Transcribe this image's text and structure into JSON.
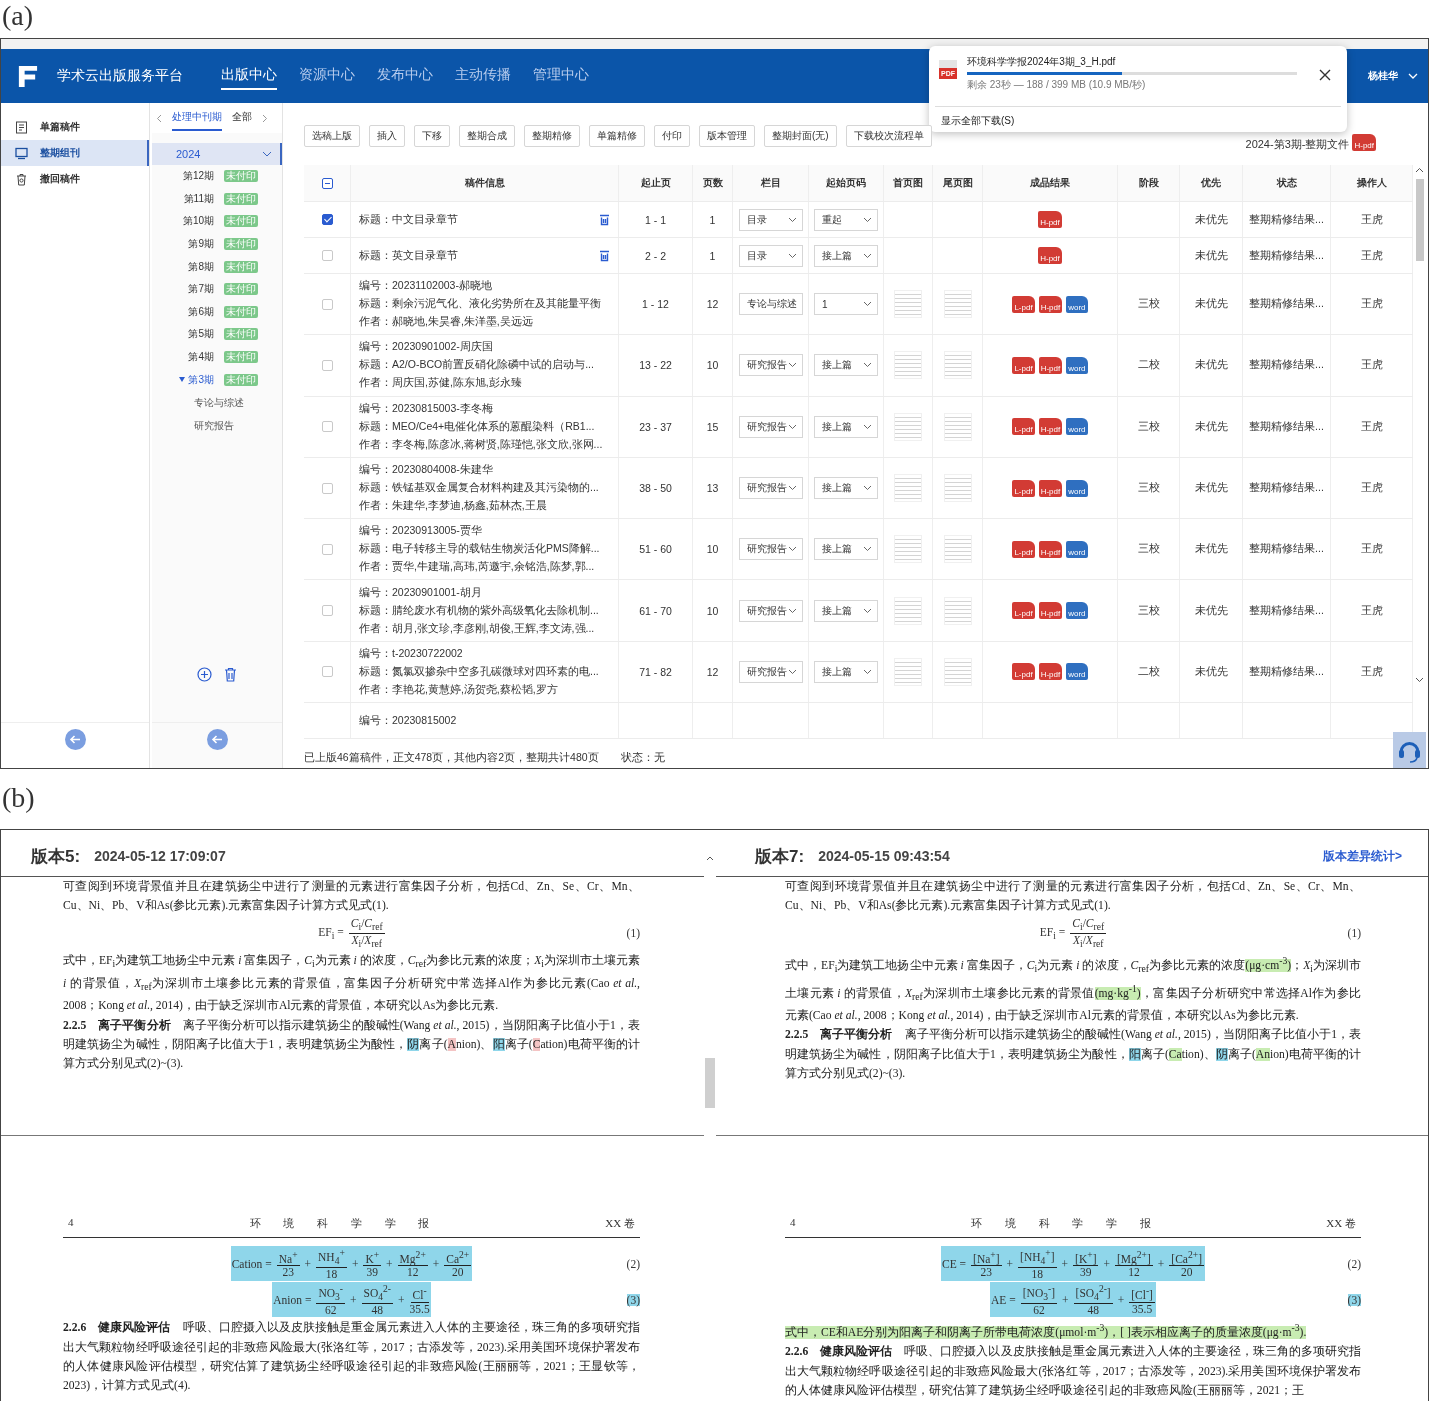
{
  "panel_a": {
    "label": "(a)",
    "header": {
      "platform_name": "学术云出版服务平台",
      "nav": [
        {
          "label": "出版中心",
          "selected": true
        },
        {
          "label": "资源中心",
          "selected": false
        },
        {
          "label": "发布中心",
          "selected": false
        },
        {
          "label": "主动传播",
          "selected": false
        },
        {
          "label": "管理中心",
          "selected": false
        }
      ],
      "user": "杨桂华"
    },
    "download_popup": {
      "file_name": "环境科学学报2024年3期_3_H.pdf",
      "file_badge": "PDF",
      "level": 0.47,
      "status": "剩余 23秒 — 188 / 399 MB (10.9 MB/秒)",
      "show_all": "显示全部下载(S)"
    },
    "sidebar": [
      {
        "label": "单篇稿件",
        "kind": "document",
        "selected": false
      },
      {
        "label": "整期组刊",
        "kind": "monitor",
        "selected": true
      },
      {
        "label": "撤回稿件",
        "kind": "trash",
        "selected": false
      }
    ],
    "issue_panel": {
      "tabs": [
        {
          "label": "处理中刊期",
          "selected": true
        },
        {
          "label": "全部",
          "selected": false
        }
      ],
      "years": [
        {
          "label": "2024",
          "expanded": true,
          "issues": [
            {
              "label": "第12期",
              "badge": "未付印",
              "selected": false,
              "expanded": false
            },
            {
              "label": "第11期",
              "badge": "未付印",
              "selected": false,
              "expanded": false
            },
            {
              "label": "第10期",
              "badge": "未付印",
              "selected": false,
              "expanded": false
            },
            {
              "label": "第9期",
              "badge": "未付印",
              "selected": false,
              "expanded": false
            },
            {
              "label": "第8期",
              "badge": "未付印",
              "selected": false,
              "expanded": false
            },
            {
              "label": "第7期",
              "badge": "未付印",
              "selected": false,
              "expanded": false
            },
            {
              "label": "第6期",
              "badge": "未付印",
              "selected": false,
              "expanded": false
            },
            {
              "label": "第5期",
              "badge": "未付印",
              "selected": false,
              "expanded": false
            },
            {
              "label": "第4期",
              "badge": "未付印",
              "selected": false,
              "expanded": false
            },
            {
              "label": "第3期",
              "badge": "未付印",
              "selected": true,
              "expanded": true,
              "children": [
                {
                  "label": "专论与综述"
                },
                {
                  "label": "研究报告"
                }
              ]
            }
          ]
        }
      ]
    },
    "toolbar": [
      "选稿上版",
      "插入",
      "下移",
      "整期合成",
      "整期精修",
      "单篇精修",
      "付印",
      "版本管理",
      "整期封面(无)",
      "下载校次流程单"
    ],
    "issue_file": {
      "label": "2024-第3期-整期文件",
      "badge": "H-pdf"
    },
    "table": {
      "select_all_partial": true,
      "columns": [
        "稿件信息",
        "起止页",
        "页数",
        "栏目",
        "起始页码",
        "首页图",
        "尾页图",
        "成品结果",
        "阶段",
        "优先",
        "状态",
        "操作人"
      ],
      "rows": [
        {
          "checked": true,
          "lines": [
            "标题：中文目录章节"
          ],
          "deletable": true,
          "pages": "1 - 1",
          "page_count": "1",
          "column": "目录",
          "start_page": "重起",
          "thumbnails": false,
          "outputs": [
            {
              "kind": "pdf",
              "label": "H-pdf"
            }
          ],
          "priority": "未优先",
          "status": "整期精修结果...",
          "operator": "王虎"
        },
        {
          "checked": false,
          "lines": [
            "标题：英文目录章节"
          ],
          "deletable": true,
          "pages": "2 - 2",
          "page_count": "1",
          "column": "目录",
          "start_page": "接上篇",
          "thumbnails": false,
          "outputs": [
            {
              "kind": "pdf",
              "label": "H-pdf"
            }
          ],
          "priority": "未优先",
          "status": "整期精修结果...",
          "operator": "王虎"
        },
        {
          "checked": false,
          "lines": [
            "编号：20231102003-郝晓地",
            "标题：剩余污泥气化、液化劣势所在及其能量平衡",
            "作者：郝晓地,朱昊睿,朱洋墨,吴远远"
          ],
          "deletable": false,
          "pages": "1 - 12",
          "page_count": "12",
          "column": "专论与综述",
          "start_page": "1",
          "thumbnails": true,
          "outputs": [
            {
              "kind": "pdf",
              "label": "L-pdf"
            },
            {
              "kind": "pdf",
              "label": "H-pdf"
            },
            {
              "kind": "word",
              "label": "word"
            }
          ],
          "stage": "三校",
          "priority": "未优先",
          "status": "整期精修结果...",
          "operator": "王虎"
        },
        {
          "checked": false,
          "lines": [
            "编号：20230901002-周庆国",
            "标题：A2/O-BCO前置反硝化除磷中试的启动与...",
            "作者：周庆国,苏健,陈东旭,彭永臻"
          ],
          "deletable": false,
          "pages": "13 - 22",
          "page_count": "10",
          "column": "研究报告",
          "start_page": "接上篇",
          "thumbnails": true,
          "outputs": [
            {
              "kind": "pdf",
              "label": "L-pdf"
            },
            {
              "kind": "pdf",
              "label": "H-pdf"
            },
            {
              "kind": "word",
              "label": "word"
            }
          ],
          "stage": "二校",
          "priority": "未优先",
          "status": "整期精修结果...",
          "operator": "王虎"
        },
        {
          "checked": false,
          "lines": [
            "编号：20230815003-李冬梅",
            "标题：MEO/Ce4+电催化体系的蒽醌染料（RB1...",
            "作者：李冬梅,陈彦冰,蒋树贤,陈瑾恺,张文欣,张网..."
          ],
          "deletable": false,
          "pages": "23 - 37",
          "page_count": "15",
          "column": "研究报告",
          "start_page": "接上篇",
          "thumbnails": true,
          "outputs": [
            {
              "kind": "pdf",
              "label": "L-pdf"
            },
            {
              "kind": "pdf",
              "label": "H-pdf"
            },
            {
              "kind": "word",
              "label": "word"
            }
          ],
          "stage": "三校",
          "priority": "未优先",
          "status": "整期精修结果...",
          "operator": "王虎"
        },
        {
          "checked": false,
          "lines": [
            "编号：20230804008-朱建华",
            "标题：铁锰基双金属复合材料构建及其污染物的...",
            "作者：朱建华,李梦迪,杨鑫,茹林杰,王晨"
          ],
          "deletable": false,
          "pages": "38 - 50",
          "page_count": "13",
          "column": "研究报告",
          "start_page": "接上篇",
          "thumbnails": true,
          "outputs": [
            {
              "kind": "pdf",
              "label": "L-pdf"
            },
            {
              "kind": "pdf",
              "label": "H-pdf"
            },
            {
              "kind": "word",
              "label": "word"
            }
          ],
          "stage": "三校",
          "priority": "未优先",
          "status": "整期精修结果...",
          "operator": "王虎"
        },
        {
          "checked": false,
          "lines": [
            "编号：20230913005-贾华",
            "标题：电子转移主导的载钴生物炭活化PMS降解...",
            "作者：贾华,牛建瑞,高玮,芮邀宇,余铭浩,陈梦,郭..."
          ],
          "deletable": false,
          "pages": "51 - 60",
          "page_count": "10",
          "column": "研究报告",
          "start_page": "接上篇",
          "thumbnails": true,
          "outputs": [
            {
              "kind": "pdf",
              "label": "L-pdf"
            },
            {
              "kind": "pdf",
              "label": "H-pdf"
            },
            {
              "kind": "word",
              "label": "word"
            }
          ],
          "stage": "三校",
          "priority": "未优先",
          "status": "整期精修结果...",
          "operator": "王虎"
        },
        {
          "checked": false,
          "lines": [
            "编号：20230901001-胡月",
            "标题：腈纶废水有机物的紫外高级氧化去除机制...",
            "作者：胡月,张文珍,李彦刚,胡俊,王辉,李文涛,强..."
          ],
          "deletable": false,
          "pages": "61 - 70",
          "page_count": "10",
          "column": "研究报告",
          "start_page": "接上篇",
          "thumbnails": true,
          "outputs": [
            {
              "kind": "pdf",
              "label": "L-pdf"
            },
            {
              "kind": "pdf",
              "label": "H-pdf"
            },
            {
              "kind": "word",
              "label": "word"
            }
          ],
          "stage": "三校",
          "priority": "未优先",
          "status": "整期精修结果...",
          "operator": "王虎"
        },
        {
          "checked": false,
          "lines": [
            "编号：t-20230722002",
            "标题：氮氯双掺杂中空多孔碳微球对四环素的电...",
            "作者：李艳花,黄慧婷,汤贺尧,蔡松韬,罗方"
          ],
          "deletable": false,
          "pages": "71 - 82",
          "page_count": "12",
          "column": "研究报告",
          "start_page": "接上篇",
          "thumbnails": true,
          "outputs": [
            {
              "kind": "pdf",
              "label": "L-pdf"
            },
            {
              "kind": "pdf",
              "label": "H-pdf"
            },
            {
              "kind": "word",
              "label": "word"
            }
          ],
          "stage": "二校",
          "priority": "未优先",
          "status": "整期精修结果...",
          "operator": "王虎"
        },
        {
          "lines": [
            "编号：20230815002"
          ]
        }
      ]
    },
    "summary": "已上版46篇稿件，正文478页，其他内容2页，整期共计480页",
    "state_text": "状态：无"
  },
  "panel_b": {
    "label": "(b)",
    "views": [
      {
        "title": "版本5:",
        "date": "2024-05-12 17:09:07",
        "pages": [
          {
            "blocks": [
              {
                "kind": "paragraph",
                "segments": [
                  {
                    "text": "可查阅到环境背景值并且在建筑扬尘中进行了测量的元素进行富集因子分析，包括Cd、Zn、Se、Cr、Mn、Cu、Ni、Pb、V和As(参比元素).元素富集因子计算方式见式(1)."
                  }
                ]
              },
              {
                "kind": "equation",
                "lhs": "EF$_{i}$ =",
                "terms": [
                  {
                    "num": "*C*$_{i}$/*C*$_{ref}$",
                    "den": "*X*$_{i}$/*X*$_{ref}$"
                  }
                ],
                "number": "(1)",
                "number_highlighted": false
              },
              {
                "kind": "paragraph",
                "segments": [
                  {
                    "text": "式中，EF$_{i}$为建筑工地扬尘中元素 *i* 富集因子，*C*$_{i}$为元素 *i* 的浓度，*C*$_{ref}$为参比元素的浓度；*X*$_{i}$为深圳市土壤元素 *i* 的背景值，*X*$_{ref}$为深圳市土壤参比元素的背景值，富集因子分析研究中常选择Al作为参比元素(Cao *et al.*, 2008；Kong *et al.*, 2014)，由于缺乏深圳市Al元素的背景值，本研究以As为参比元素."
                  }
                ]
              },
              {
                "kind": "paragraph",
                "segments": [
                  {
                    "text": "**2.2.5　离子平衡分析**　离子平衡分析可以指示建筑扬尘的酸碱性(Wang *et al.*, 2015)，当阴阳离子比值小于1，表明建筑扬尘为碱性，阴阳离子比值大于1，表明建筑扬尘为酸性，"
                  },
                  {
                    "text": "阴",
                    "color": "#8fd6ea"
                  },
                  {
                    "text": "离子("
                  },
                  {
                    "text": "A",
                    "color": "#f4c4c4"
                  },
                  {
                    "text": "nion)、"
                  },
                  {
                    "text": "阳",
                    "color": "#8fd6ea"
                  },
                  {
                    "text": "离子("
                  },
                  {
                    "text": "C",
                    "color": "#f4c4c4"
                  },
                  {
                    "text": "ation)电荷平衡的计算方式分别见式(2)~(3)."
                  }
                ]
              }
            ]
          },
          {
            "running_head": {
              "page": "4",
              "journal": "环 境 科 学 学 报",
              "volume": "XX 卷"
            },
            "blocks": [
              {
                "kind": "equation",
                "lhs": "Cation =",
                "terms": [
                  {
                    "num": "Na$^{+}$",
                    "den": "23"
                  },
                  {
                    "op": "+",
                    "num": "NH$_{4}$$^{+}$",
                    "den": "18"
                  },
                  {
                    "op": "+",
                    "num": "K$^{+}$",
                    "den": "39"
                  },
                  {
                    "op": "+",
                    "num": "Mg$^{2+}$",
                    "den": "12"
                  },
                  {
                    "op": "+",
                    "num": "Ca$^{2+}$",
                    "den": "20"
                  }
                ],
                "number": "(2)",
                "color": "#8fd6ea",
                "number_highlighted": false
              },
              {
                "kind": "equation",
                "lhs": "Anion =",
                "terms": [
                  {
                    "num": "NO$_{3}$$^{-}$",
                    "den": "62"
                  },
                  {
                    "op": "+",
                    "num": "SO$_{4}$$^{2-}$",
                    "den": "48"
                  },
                  {
                    "op": "+",
                    "num": "Cl$^{-}$",
                    "den": "35.5"
                  }
                ],
                "number": "(3)",
                "color": "#8fd6ea",
                "number_highlighted": true
              },
              {
                "kind": "paragraph",
                "segments": [
                  {
                    "text": "**2.2.6　健康风险评估**　呼吸、口腔摄入以及皮肤接触是重金属元素进入人体的主要途径，珠三角的多项研究指出大气颗粒物经呼吸途径引起的非致癌风险最大(张洛红等，2017；古添发等，2023).采用美国环境保护署发布的人体健康风险评估模型，研究估算了建筑扬尘经呼吸途径引起的非致癌风险(王丽丽等，2021；王显钦等，2023)，计算方式见式(4)."
                  }
                ]
              }
            ]
          }
        ]
      },
      {
        "title": "版本7:",
        "date": "2024-05-15 09:43:54",
        "link": "版本差异统计>",
        "pages": [
          {
            "blocks": [
              {
                "kind": "paragraph",
                "segments": [
                  {
                    "text": "可查阅到环境背景值并且在建筑扬尘中进行了测量的元素进行富集因子分析，包括Cd、Zn、Se、Cr、Mn、Cu、Ni、Pb、V和As(参比元素).元素富集因子计算方式见式(1)."
                  }
                ]
              },
              {
                "kind": "equation",
                "lhs": "EF$_{i}$ =",
                "terms": [
                  {
                    "num": "*C*$_{i}$/*C*$_{ref}$",
                    "den": "*X*$_{i}$/*X*$_{ref}$"
                  }
                ],
                "number": "(1)",
                "number_highlighted": false
              },
              {
                "kind": "paragraph",
                "segments": [
                  {
                    "text": "式中，EF$_{i}$为建筑工地扬尘中元素 *i* 富集因子，*C*$_{i}$为元素 *i* 的浓度，*C*$_{ref}$为参比元素的浓度"
                  },
                  {
                    "text": "(μg·cm$^{-3}$)",
                    "color": "#c8ecb2"
                  },
                  {
                    "text": "；*X*$_{i}$为深圳市土壤元素 *i* 的背景值，*X*$_{ref}$为深圳市土壤参比元素的背景值"
                  },
                  {
                    "text": "(mg·kg$^{-1}$)",
                    "color": "#c8ecb2"
                  },
                  {
                    "text": "，富集因子分析研究中常选择Al作为参比元素(Cao *et al.*, 2008；Kong *et al.*, 2014)，由于缺乏深圳市Al元素的背景值，本研究以As为参比元素."
                  }
                ]
              },
              {
                "kind": "paragraph",
                "segments": [
                  {
                    "text": "**2.2.5　离子平衡分析**　离子平衡分析可以指示建筑扬尘的酸碱性(Wang *et al.*, 2015)，当阴阳离子比值小于1，表明建筑扬尘为碱性，阴阳离子比值大于1，表明建筑扬尘为酸性，"
                  },
                  {
                    "text": "阳",
                    "color": "#8fd6ea"
                  },
                  {
                    "text": "离子("
                  },
                  {
                    "text": "Ca",
                    "color": "#c8ecb2"
                  },
                  {
                    "text": "tion)、"
                  },
                  {
                    "text": "阴",
                    "color": "#8fd6ea"
                  },
                  {
                    "text": "离子("
                  },
                  {
                    "text": "An",
                    "color": "#c8ecb2"
                  },
                  {
                    "text": "ion)电荷平衡的计算方式分别见式(2)~(3)."
                  }
                ]
              }
            ]
          },
          {
            "running_head": {
              "page": "4",
              "journal": "环 境 科 学 学 报",
              "volume": "XX 卷"
            },
            "blocks": [
              {
                "kind": "equation",
                "lhs": "CE =",
                "terms": [
                  {
                    "num": "[Na$^{+}$]",
                    "den": "23"
                  },
                  {
                    "op": "+",
                    "num": "[NH$_{4}$$^{+}$]",
                    "den": "18"
                  },
                  {
                    "op": "+",
                    "num": "[K$^{+}$]",
                    "den": "39"
                  },
                  {
                    "op": "+",
                    "num": "[Mg$^{2+}$]",
                    "den": "12"
                  },
                  {
                    "op": "+",
                    "num": "[Ca$^{2+}$]",
                    "den": "20"
                  }
                ],
                "number": "(2)",
                "color": "#8fd6ea",
                "number_highlighted": false
              },
              {
                "kind": "equation",
                "lhs": "AE =",
                "terms": [
                  {
                    "num": "[NO$_{3}$$^{-}$]",
                    "den": "62"
                  },
                  {
                    "op": "+",
                    "num": "[SO$_{4}$$^{2-}$]",
                    "den": "48"
                  },
                  {
                    "op": "+",
                    "num": "[Cl$^{-}$]",
                    "den": "35.5"
                  }
                ],
                "number": "(3)",
                "color": "#8fd6ea",
                "number_highlighted": true
              },
              {
                "kind": "paragraph",
                "segments": [
                  {
                    "text": "式中，CE和AE分别为阳离子和阴离子所带电荷浓度(μmol·m$^{-3}$)，[ ]表示相应离子的质量浓度(μg·m$^{-3}$).",
                    "color": "#c8ecb2"
                  }
                ]
              },
              {
                "kind": "paragraph",
                "segments": [
                  {
                    "text": "**2.2.6　健康风险评估**　呼吸、口腔摄入以及皮肤接触是重金属元素进入人体的主要途径，珠三角的多项研究指出大气颗粒物经呼吸途径引起的非致癌风险最大(张洛红等，2017；古添发等，2023).采用美国环境保护署发布的人体健康风险评估模型，研究估算了建筑扬尘经呼吸途径引起的非致癌风险(王丽丽等，2021；王"
                  }
                ]
              }
            ]
          }
        ]
      }
    ]
  }
}
